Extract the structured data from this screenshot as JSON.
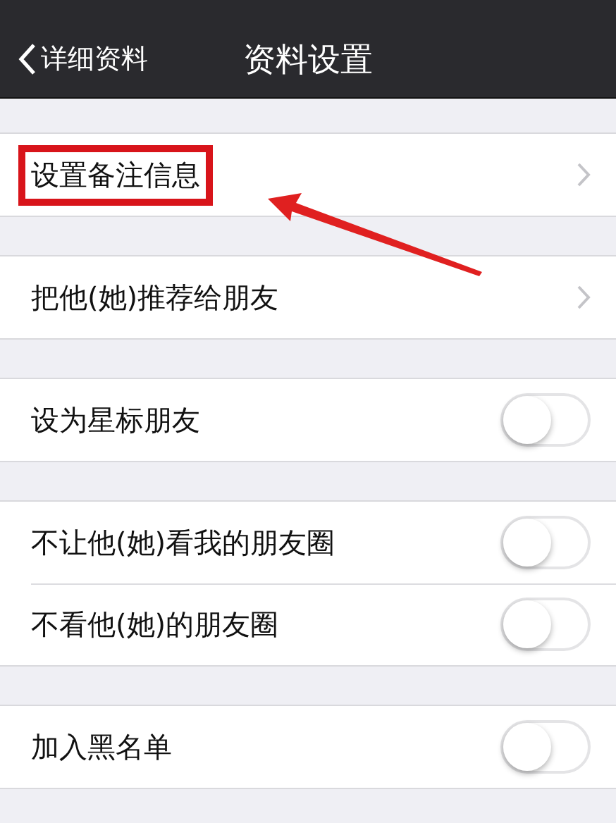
{
  "nav_bar": {
    "back_label": "详细资料",
    "title": "资料设置"
  },
  "groups": [
    {
      "items": [
        {
          "kind": "link",
          "label": "设置备注信息",
          "highlighted": true
        }
      ]
    },
    {
      "items": [
        {
          "kind": "link",
          "label": "把他(她)推荐给朋友",
          "highlighted": false
        }
      ]
    },
    {
      "items": [
        {
          "kind": "switch",
          "label": "设为星标朋友",
          "on": false,
          "highlighted": false
        }
      ]
    },
    {
      "items": [
        {
          "kind": "switch",
          "label": "不让他(她)看我的朋友圈",
          "on": false,
          "highlighted": false
        },
        {
          "kind": "switch",
          "label": "不看他(她)的朋友圈",
          "on": false,
          "highlighted": false
        }
      ]
    },
    {
      "items": [
        {
          "kind": "switch",
          "label": "加入黑名单",
          "on": false,
          "highlighted": false
        }
      ]
    }
  ]
}
